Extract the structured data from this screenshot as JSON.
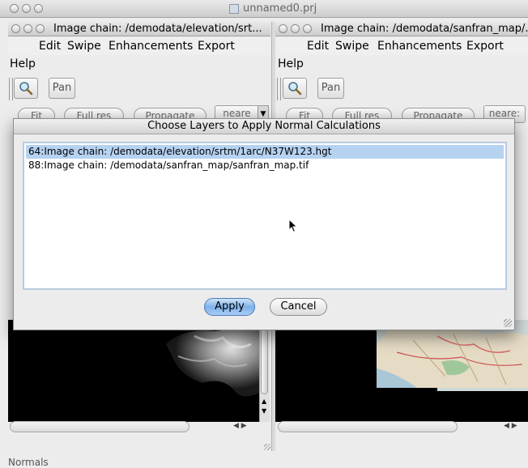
{
  "app": {
    "title": "unnamed0.prj"
  },
  "left_window": {
    "title": "Image chain: /demodata/elevation/srt...",
    "menu": [
      "Edit",
      "Swipe",
      "Enhancements",
      "Export"
    ],
    "menu_help": "Help",
    "tools": {
      "zoom_icon": "magnifier-icon",
      "pan_label": "Pan"
    },
    "buttons": [
      "Fit",
      "Full res",
      "Propagate",
      "neare"
    ]
  },
  "right_window": {
    "title": "Image chain: /demodata/sanfran_map/...",
    "menu": [
      "Edit",
      "Swipe",
      "Enhancements",
      "Export"
    ],
    "menu_help": "Help",
    "tools": {
      "zoom_icon": "magnifier-icon",
      "pan_label": "Pan"
    },
    "buttons": [
      "Fit",
      "Full res",
      "Propagate",
      "neare:"
    ]
  },
  "dialog": {
    "title": "Choose Layers to Apply Normal Calculations",
    "items": [
      {
        "label": "64:Image chain: /demodata/elevation/srtm/1arc/N37W123.hgt",
        "selected": true
      },
      {
        "label": "88:Image chain: /demodata/sanfran_map/sanfran_map.tif",
        "selected": false
      }
    ],
    "apply_label": "Apply",
    "cancel_label": "Cancel"
  },
  "status": {
    "text": "Normals"
  },
  "colors": {
    "selection": "#b6d2f1",
    "default_button": "#7fb1ea"
  }
}
